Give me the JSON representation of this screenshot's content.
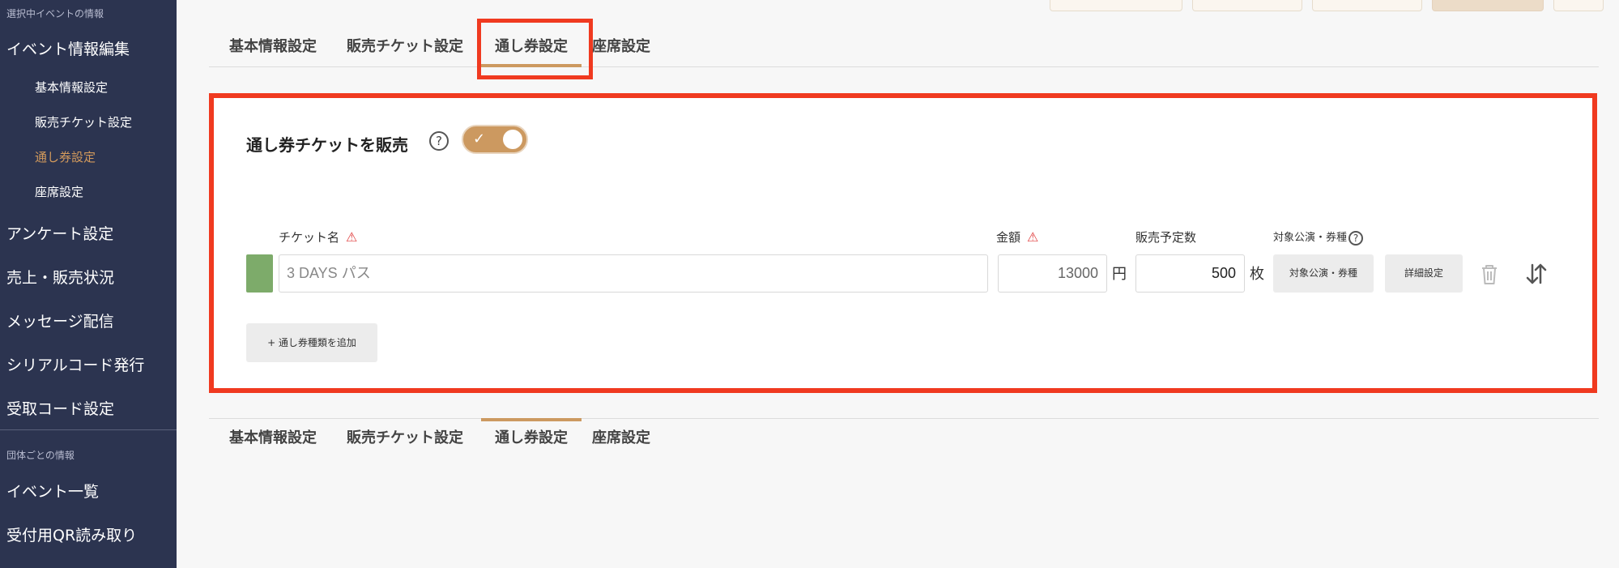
{
  "sidebar": {
    "section_event": "選択中イベントの情報",
    "event_edit": "イベント情報編集",
    "sub_items": [
      "基本情報設定",
      "販売チケット設定",
      "通し券設定",
      "座席設定"
    ],
    "survey": "アンケート設定",
    "sales_status": "売上・販売状況",
    "message": "メッセージ配信",
    "serial": "シリアルコード発行",
    "receipt_code": "受取コード設定",
    "section_org": "団体ごとの情報",
    "event_list": "イベント一覧",
    "qr_reader": "受付用QR読み取り"
  },
  "tabs": [
    "基本情報設定",
    "販売チケット設定",
    "通し券設定",
    "座席設定"
  ],
  "active_tab": "通し券設定",
  "season_pass": {
    "title": "通し券チケットを販売",
    "toggle_on": true,
    "labels": {
      "ticket_name": "チケット名",
      "price": "金額",
      "planned_count": "販売予定数",
      "target": "対象公演・券種"
    },
    "row": {
      "color": "#7dab6a",
      "name": "3 DAYS パス",
      "price": "13000",
      "price_unit": "円",
      "count": "500",
      "count_unit": "枚",
      "target_button": "対象公演・券種",
      "detail_button": "詳細設定"
    },
    "add_button": "+ 通し券種類を追加"
  },
  "colors": {
    "sidebar_bg": "#2c3450",
    "accent": "#cc9960",
    "highlight": "#f03a20"
  }
}
